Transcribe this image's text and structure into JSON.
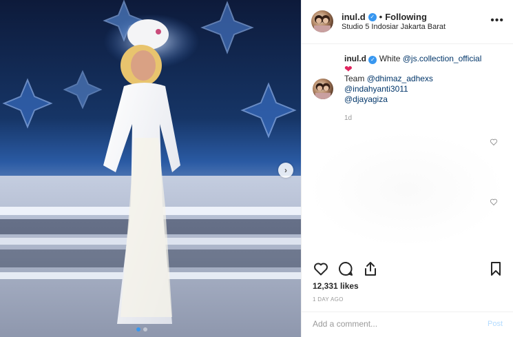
{
  "header": {
    "username": "inul.d",
    "separator": "•",
    "follow_status": "Following",
    "location": "Studio 5 Indosiar Jakarta Barat",
    "more_icon": "more-horizontal-icon"
  },
  "caption": {
    "username": "inul.d",
    "text_1": "White",
    "mention_1": "@js.collection_official",
    "emoji": "❤",
    "team_label": "Team",
    "mention_2": "@dhimaz_adhexs",
    "mention_3": "@indahyanti3011",
    "mention_4": "@djayagiza",
    "time": "1d"
  },
  "actions": {
    "like_icon": "heart-icon",
    "comment_icon": "comment-icon",
    "share_icon": "share-icon",
    "save_icon": "bookmark-icon"
  },
  "stats": {
    "likes": "12,331 likes",
    "posted": "1 DAY AGO"
  },
  "comment": {
    "placeholder": "Add a comment...",
    "post_label": "Post"
  },
  "media": {
    "next_glyph": "›",
    "carousel_count": 2,
    "carousel_active": 1
  },
  "colors": {
    "accent": "#3897f0",
    "link": "#003569",
    "post_disabled": "#b3dbff",
    "heart": "#e0245e"
  }
}
